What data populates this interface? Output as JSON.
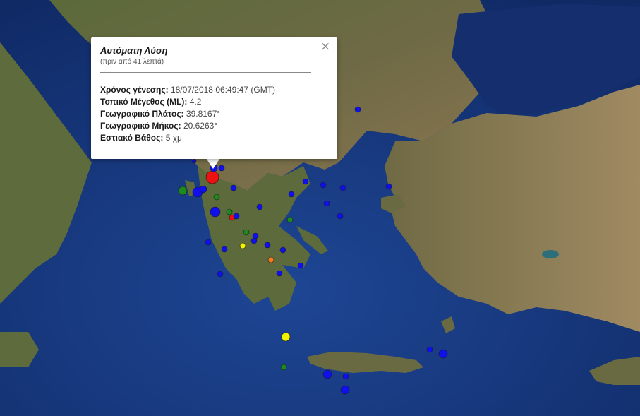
{
  "popup": {
    "title": "Αυτόματη Λύση",
    "subtitle": "(πριν από 41 λεπτά)",
    "rows": [
      {
        "label": "Χρόνος γένεσης:",
        "value": "18/07/2018  06:49:47 (GMT)"
      },
      {
        "label": "Τοπικό Μέγεθος (ML):",
        "value": "4.2"
      },
      {
        "label": "Γεωγραφικό Πλάτος:",
        "value": "39.8167°"
      },
      {
        "label": "Γεωγραφικό Μήκος:",
        "value": "20.6263°"
      },
      {
        "label": "Εστιακό Βάθος:",
        "value": "5 χμ"
      }
    ],
    "close_icon": "close-icon"
  },
  "colors": {
    "sea": "#1b3f86",
    "land": "#5f6a3a",
    "marker_blue": "#1010ee",
    "marker_green": "#1e8a1e",
    "marker_red": "#ee1111",
    "marker_yellow": "#f2f200",
    "marker_orange": "#f07c1e"
  }
}
